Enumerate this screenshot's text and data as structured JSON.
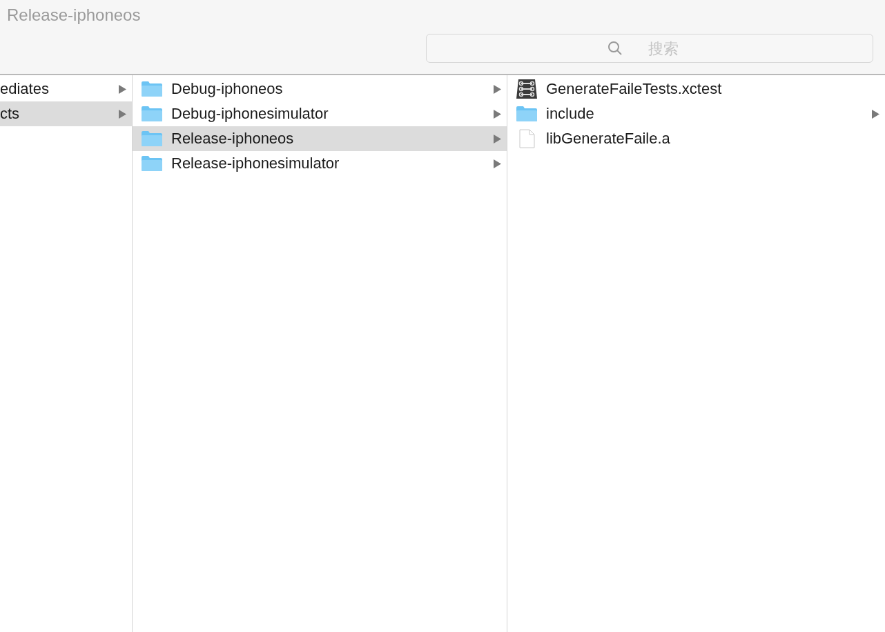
{
  "window": {
    "title": "Release-iphoneos"
  },
  "search": {
    "placeholder": "搜索"
  },
  "columns": [
    {
      "items": [
        {
          "name": "ediates",
          "kind": "plain",
          "has_children": true,
          "selected": false
        },
        {
          "name": "cts",
          "kind": "plain",
          "has_children": true,
          "selected": true
        }
      ]
    },
    {
      "items": [
        {
          "name": "Debug-iphoneos",
          "kind": "folder",
          "has_children": true,
          "selected": false
        },
        {
          "name": "Debug-iphonesimulator",
          "kind": "folder",
          "has_children": true,
          "selected": false
        },
        {
          "name": "Release-iphoneos",
          "kind": "folder",
          "has_children": true,
          "selected": true
        },
        {
          "name": "Release-iphonesimulator",
          "kind": "folder",
          "has_children": true,
          "selected": false
        }
      ]
    },
    {
      "items": [
        {
          "name": "GenerateFaileTests.xctest",
          "kind": "bundle",
          "has_children": false,
          "selected": false
        },
        {
          "name": "include",
          "kind": "folder",
          "has_children": true,
          "selected": false
        },
        {
          "name": "libGenerateFaile.a",
          "kind": "file",
          "has_children": false,
          "selected": false
        }
      ]
    }
  ]
}
